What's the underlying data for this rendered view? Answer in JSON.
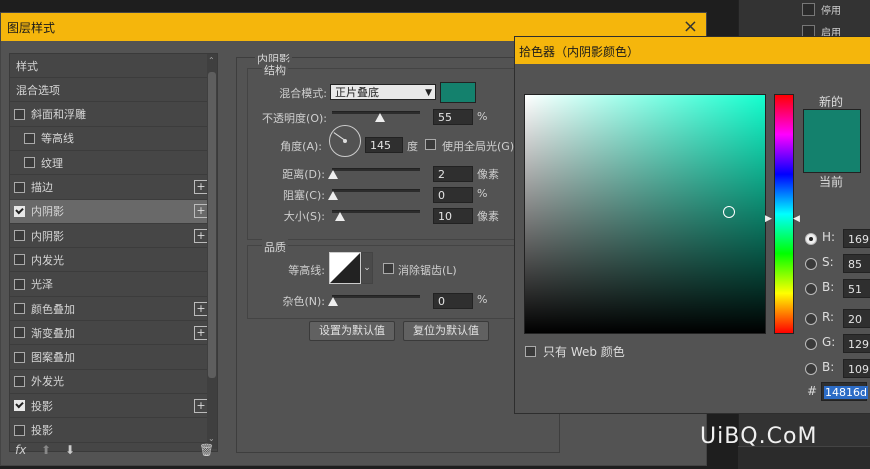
{
  "background_panel": {
    "rows": [
      "停用",
      "启用"
    ]
  },
  "dialog": {
    "title": "图层样式",
    "sidebar": {
      "items": [
        {
          "label": "样式",
          "checkbox": false,
          "checked": false,
          "plus": false,
          "selected": false,
          "indent": false
        },
        {
          "label": "混合选项",
          "checkbox": false,
          "checked": false,
          "plus": false,
          "selected": false,
          "indent": false
        },
        {
          "label": "斜面和浮雕",
          "checkbox": true,
          "checked": false,
          "plus": false,
          "selected": false,
          "indent": false
        },
        {
          "label": "等高线",
          "checkbox": true,
          "checked": false,
          "plus": false,
          "selected": false,
          "indent": true
        },
        {
          "label": "纹理",
          "checkbox": true,
          "checked": false,
          "plus": false,
          "selected": false,
          "indent": true
        },
        {
          "label": "描边",
          "checkbox": true,
          "checked": false,
          "plus": true,
          "selected": false,
          "indent": false
        },
        {
          "label": "内阴影",
          "checkbox": true,
          "checked": true,
          "plus": true,
          "selected": true,
          "indent": false
        },
        {
          "label": "内阴影",
          "checkbox": true,
          "checked": false,
          "plus": true,
          "selected": false,
          "indent": false
        },
        {
          "label": "内发光",
          "checkbox": true,
          "checked": false,
          "plus": false,
          "selected": false,
          "indent": false
        },
        {
          "label": "光泽",
          "checkbox": true,
          "checked": false,
          "plus": false,
          "selected": false,
          "indent": false
        },
        {
          "label": "颜色叠加",
          "checkbox": true,
          "checked": false,
          "plus": true,
          "selected": false,
          "indent": false
        },
        {
          "label": "渐变叠加",
          "checkbox": true,
          "checked": false,
          "plus": true,
          "selected": false,
          "indent": false
        },
        {
          "label": "图案叠加",
          "checkbox": true,
          "checked": false,
          "plus": false,
          "selected": false,
          "indent": false
        },
        {
          "label": "外发光",
          "checkbox": true,
          "checked": false,
          "plus": false,
          "selected": false,
          "indent": false
        },
        {
          "label": "投影",
          "checkbox": true,
          "checked": true,
          "plus": true,
          "selected": false,
          "indent": false
        },
        {
          "label": "投影",
          "checkbox": true,
          "checked": false,
          "plus": false,
          "selected": false,
          "indent": false
        }
      ]
    },
    "fx_label": "fx",
    "inner_shadow": {
      "section_title": "内阴影",
      "structure_title": "结构",
      "blend_mode_label": "混合模式:",
      "blend_mode_value": "正片叠底",
      "shadow_color": "#14816d",
      "opacity_label": "不透明度(O):",
      "opacity_value": "55",
      "opacity_percent": 55,
      "opacity_unit": "%",
      "angle_label": "角度(A):",
      "angle_value": "145",
      "angle_unit": "度",
      "global_light_label": "使用全局光(G)",
      "distance_label": "距离(D):",
      "distance_value": "2",
      "distance_unit": "像素",
      "choke_label": "阻塞(C):",
      "choke_value": "0",
      "choke_unit": "%",
      "size_label": "大小(S):",
      "size_value": "10",
      "size_unit": "像素",
      "quality_title": "品质",
      "contour_label": "等高线:",
      "antialias_label": "消除锯齿(L)",
      "noise_label": "杂色(N):",
      "noise_value": "0",
      "noise_unit": "%",
      "make_default_label": "设置为默认值",
      "reset_default_label": "复位为默认值"
    }
  },
  "color_picker": {
    "title": "拾色器（内阴影颜色）",
    "new_label": "新的",
    "current_label": "当前",
    "new_color": "#14816d",
    "web_only_label": "只有 Web 颜色",
    "fields": [
      {
        "label": "H:",
        "value": "169",
        "selected": true
      },
      {
        "label": "S:",
        "value": "85",
        "selected": false
      },
      {
        "label": "B:",
        "value": "51",
        "selected": false
      },
      {
        "label": "R:",
        "value": "20",
        "selected": false
      },
      {
        "label": "G:",
        "value": "129",
        "selected": false
      },
      {
        "label": "B:",
        "value": "109",
        "selected": false
      }
    ],
    "hex_label": "#",
    "hex_value": "14816d"
  },
  "watermark": "UiBQ.CoM"
}
